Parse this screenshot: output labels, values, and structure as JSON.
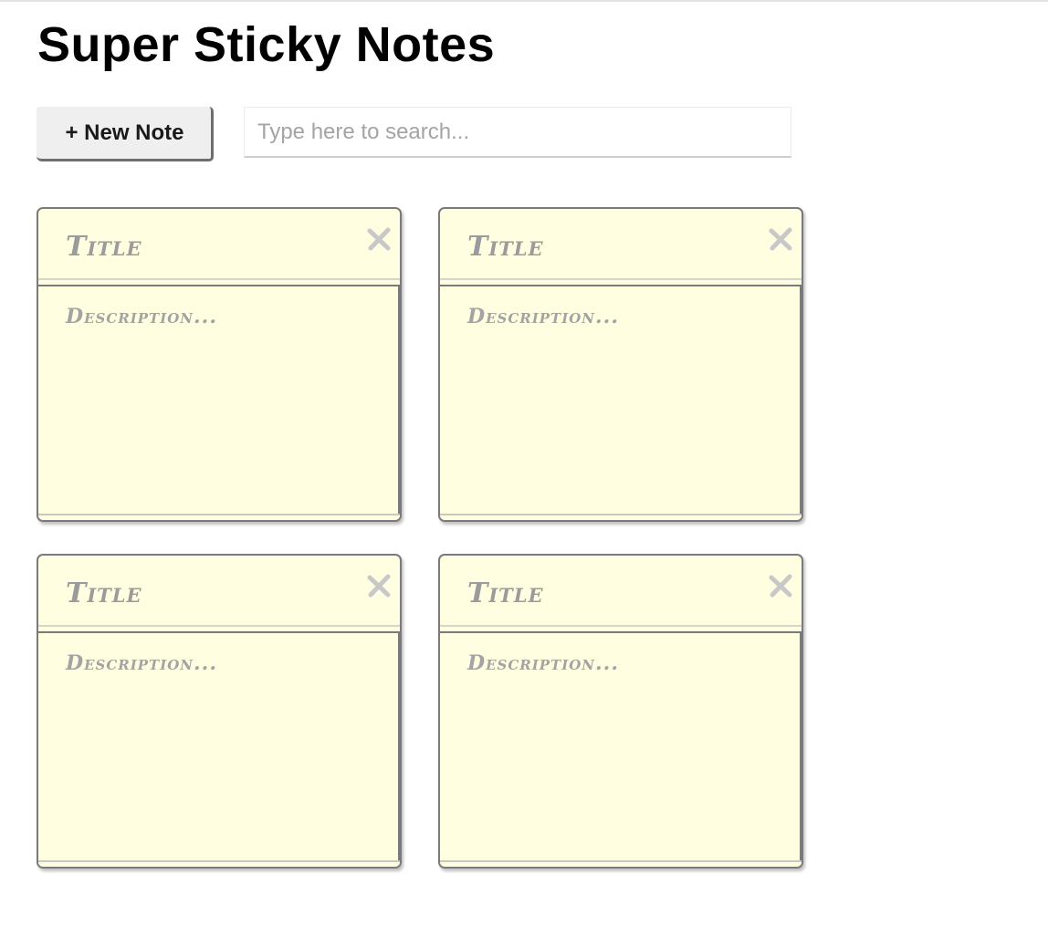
{
  "app": {
    "title": "Super Sticky Notes"
  },
  "toolbar": {
    "new_note_label": "+ New Note",
    "search_placeholder": "Type here to search..."
  },
  "notes": [
    {
      "title": "Title",
      "description": "Description...",
      "close_icon": "close-icon"
    },
    {
      "title": "Title",
      "description": "Description...",
      "close_icon": "close-icon"
    },
    {
      "title": "Title",
      "description": "Description...",
      "close_icon": "close-icon"
    },
    {
      "title": "Title",
      "description": "Description...",
      "close_icon": "close-icon"
    }
  ],
  "colors": {
    "note_background": "#fffee0",
    "note_border": "#7a7a7a",
    "placeholder_text": "#9b9b9b",
    "close_icon": "#c8c8c8",
    "button_background": "#efefef"
  }
}
